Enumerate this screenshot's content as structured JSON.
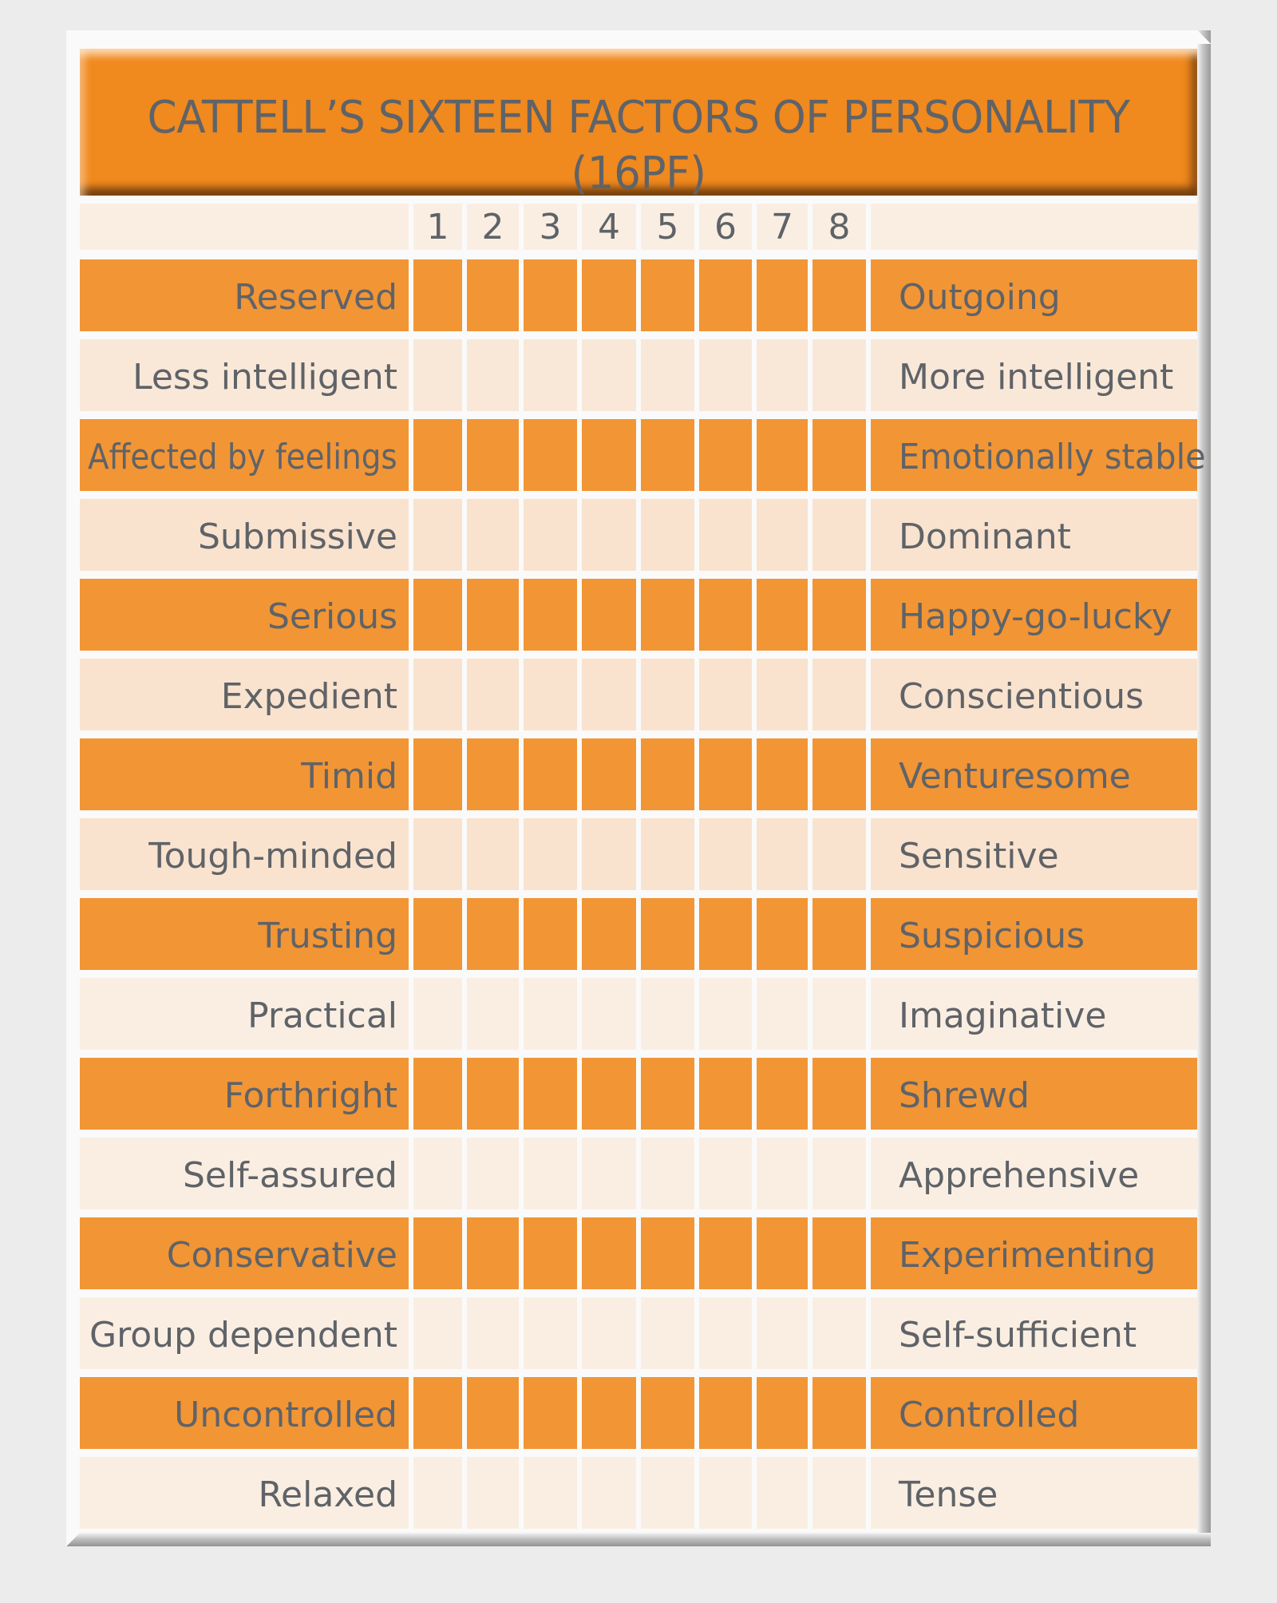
{
  "title": {
    "line1": "CATTELL’S SIXTEEN FACTORS OF PERSONALITY",
    "line2": "(16PF)"
  },
  "scale": {
    "columns": [
      "1",
      "2",
      "3",
      "4",
      "5",
      "6",
      "7",
      "8"
    ]
  },
  "colors": {
    "header": "#f0891e",
    "dark_row": "#f29535",
    "light_row": "#faeee2",
    "light_row_alt": "#f9e3ce",
    "text": "#5f6368",
    "background": "#ececec"
  },
  "factors": [
    {
      "left": "Reserved",
      "right": "Outgoing",
      "tone": "dark"
    },
    {
      "left": "Less intelligent",
      "right": "More intelligent",
      "tone": "light-c"
    },
    {
      "left": "Affected by feelings",
      "right": "Emotionally stable",
      "tone": "dark"
    },
    {
      "left": "Submissive",
      "right": "Dominant",
      "tone": "light-b"
    },
    {
      "left": "Serious",
      "right": "Happy-go-lucky",
      "tone": "dark"
    },
    {
      "left": "Expedient",
      "right": "Conscientious",
      "tone": "light-b"
    },
    {
      "left": "Timid",
      "right": "Venturesome",
      "tone": "dark"
    },
    {
      "left": "Tough-minded",
      "right": "Sensitive",
      "tone": "light-b"
    },
    {
      "left": "Trusting",
      "right": "Suspicious",
      "tone": "dark"
    },
    {
      "left": "Practical",
      "right": "Imaginative",
      "tone": "light-a"
    },
    {
      "left": "Forthright",
      "right": "Shrewd",
      "tone": "dark"
    },
    {
      "left": "Self-assured",
      "right": "Apprehensive",
      "tone": "light-a"
    },
    {
      "left": "Conservative",
      "right": "Experimenting",
      "tone": "dark"
    },
    {
      "left": "Group dependent",
      "right": "Self-sufficient",
      "tone": "light-a"
    },
    {
      "left": "Uncontrolled",
      "right": "Controlled",
      "tone": "dark"
    },
    {
      "left": "Relaxed",
      "right": "Tense",
      "tone": "light-a"
    }
  ]
}
